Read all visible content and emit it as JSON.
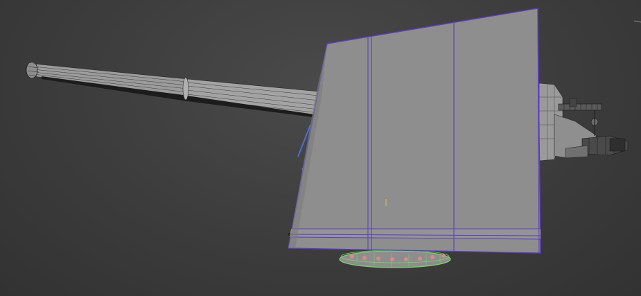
{
  "viewport": {
    "kind": "3d-viewport",
    "shading": "wireframe-over-shaded",
    "background_color": "#3c3c3c",
    "selection_color": "#5a3fc0",
    "subobject_selection_color": "#7bd36a",
    "mesh_color": "#8a8a8a"
  },
  "model": {
    "parts": [
      {
        "name": "barrel",
        "selected": false
      },
      {
        "name": "gun-shield",
        "selected": true
      },
      {
        "name": "breech-mechanism",
        "selected": false
      },
      {
        "name": "turret-base-ring",
        "selected": false
      }
    ]
  }
}
